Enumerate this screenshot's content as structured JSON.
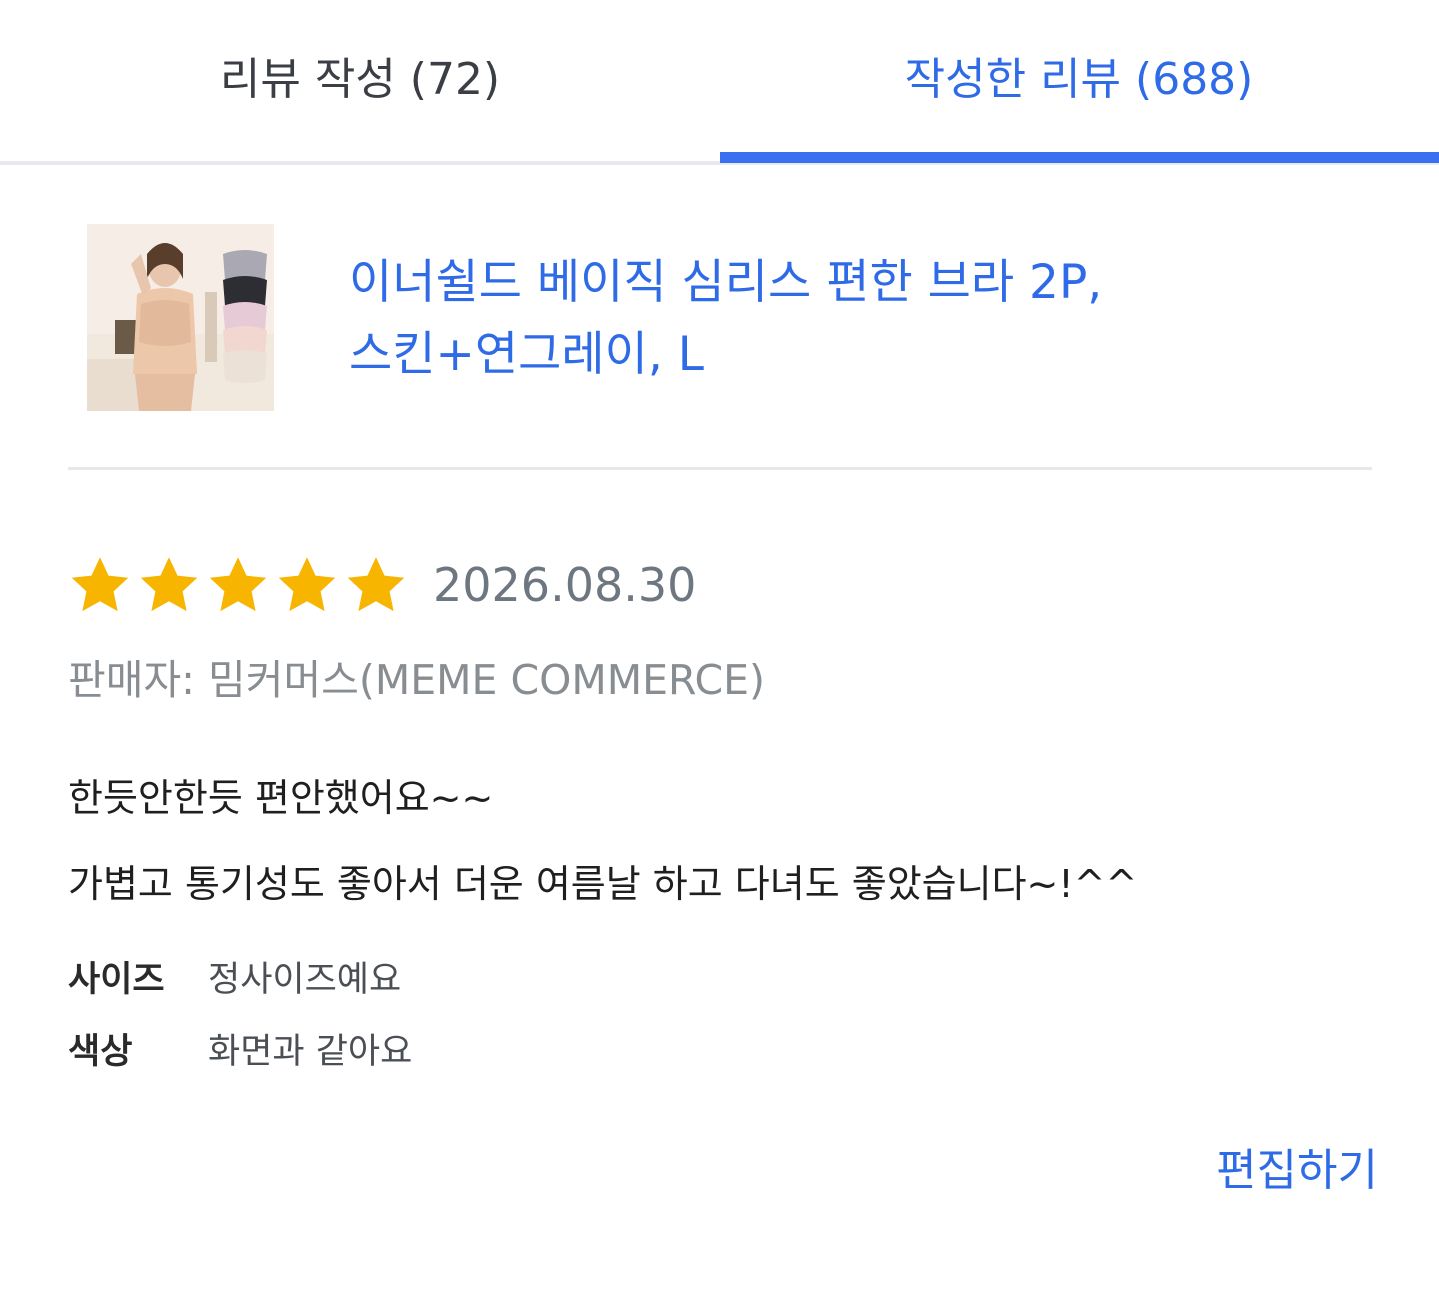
{
  "tabs": {
    "write_label": "리뷰 작성 (72)",
    "written_label": "작성한 리뷰 (688)",
    "active": "written"
  },
  "product": {
    "name_line1": "이너쉴드 베이직 심리스 편한 브라 2P,",
    "name_line2": "스킨+연그레이, L"
  },
  "review": {
    "rating": 5,
    "rating_max": 5,
    "date": "2026.08.30",
    "seller": "판매자: 밈커머스(MEME COMMERCE)",
    "body_lines": [
      "한듯안한듯 편안했어요~~",
      "가볍고 통기성도 좋아서 더운 여름날 하고 다녀도 좋았습니다~!^^"
    ],
    "attributes": [
      {
        "label": "사이즈",
        "value": "정사이즈예요"
      },
      {
        "label": "색상",
        "value": "화면과 같아요"
      }
    ]
  },
  "actions": {
    "edit_label": "편집하기"
  },
  "colors": {
    "accent": "#2f6be6",
    "tab_indicator": "#3a6ff0",
    "star": "#f7b500",
    "divider": "#e6e8eb"
  }
}
